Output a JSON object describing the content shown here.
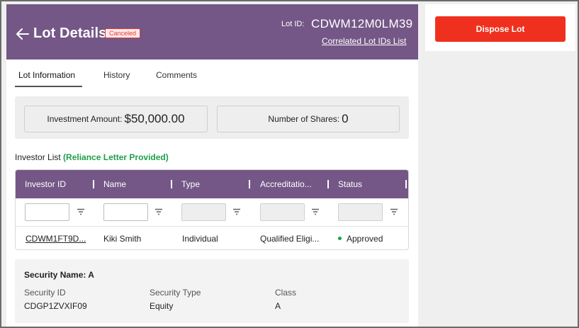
{
  "header": {
    "title": "Lot Details",
    "status_badge": "Canceled",
    "lot_id_label": "Lot ID:",
    "lot_id_value": "CDWM12M0LM39",
    "correlated_link": "Correlated Lot IDs List",
    "icons": {
      "back": "arrow-left-icon"
    }
  },
  "tabs": [
    {
      "label": "Lot Information",
      "active": true
    },
    {
      "label": "History",
      "active": false
    },
    {
      "label": "Comments",
      "active": false
    }
  ],
  "summary": {
    "investment_label": "Investment Amount:",
    "investment_value": "$50,000.00",
    "shares_label": "Number of Shares:",
    "shares_value": "0"
  },
  "investor_list": {
    "title": "Investor List",
    "note": "(Reliance Letter Provided)",
    "columns": [
      "Investor ID",
      "Name",
      "Type",
      "Accreditatio...",
      "Status"
    ],
    "rows": [
      {
        "investor_id": "CDWM1FT9D...",
        "name": "Kiki Smith",
        "type": "Individual",
        "accreditation": "Qualified Eligi...",
        "status": "Approved"
      }
    ]
  },
  "security": {
    "title": "Security Name: A",
    "fields": [
      {
        "label": "Security ID",
        "value": "CDGP1ZVXIF09"
      },
      {
        "label": "Security Type",
        "value": "Equity"
      },
      {
        "label": "Class",
        "value": "A"
      }
    ]
  },
  "actions": {
    "dispose_label": "Dispose Lot"
  },
  "colors": {
    "header_purple": "#745786",
    "danger_red": "#f0301e",
    "badge_red": "#e53935",
    "success_green": "#1e9e4a",
    "panel_gray": "#eeeeee"
  }
}
